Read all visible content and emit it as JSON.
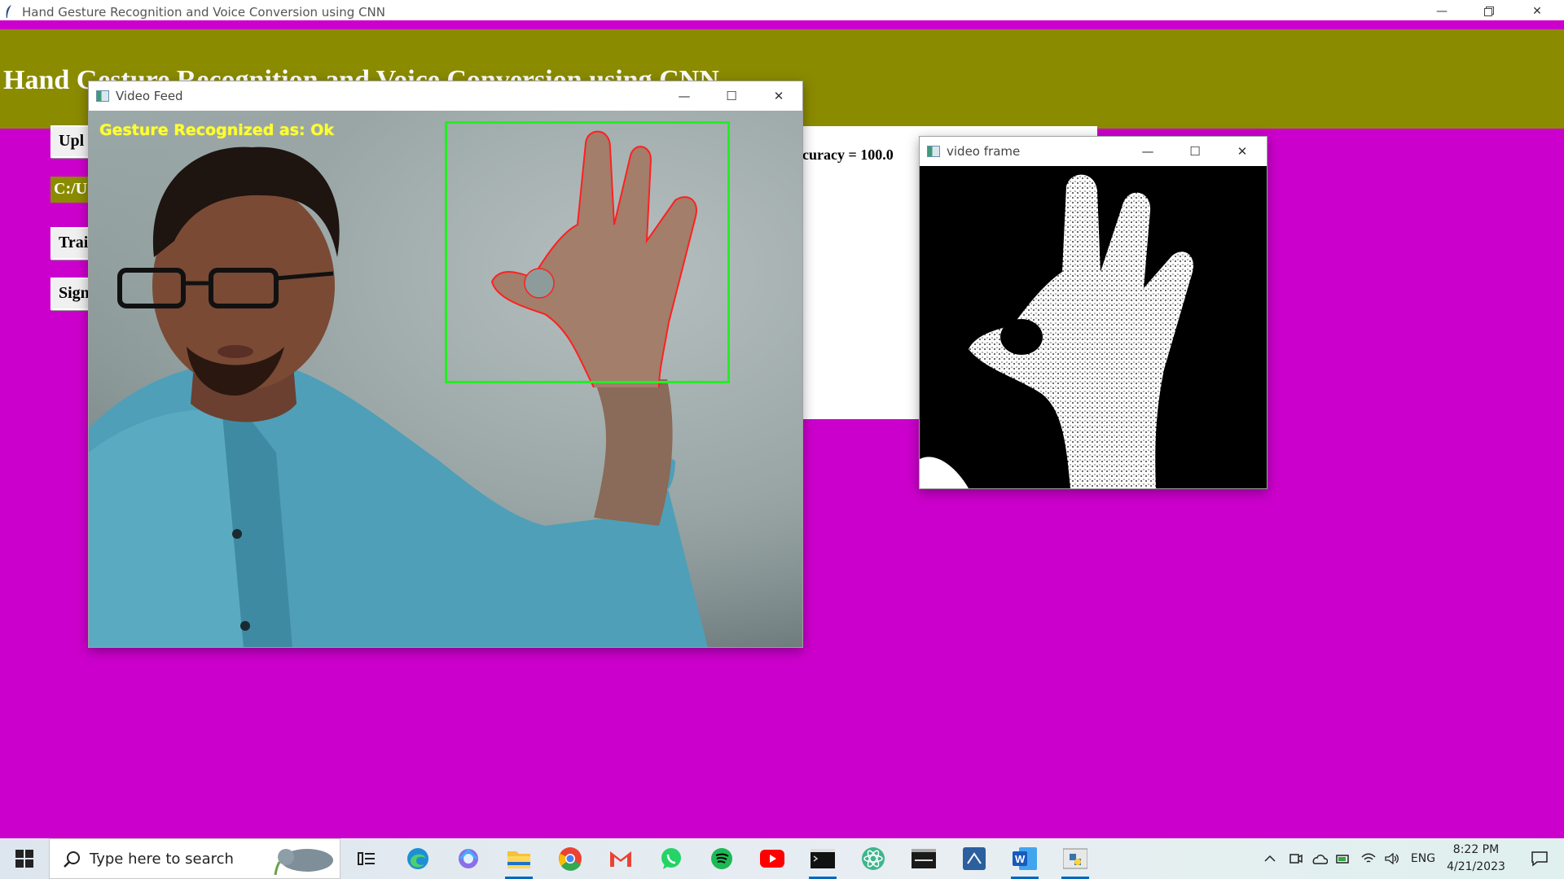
{
  "app": {
    "window_title": "Hand Gesture Recognition and Voice Conversion using CNN",
    "heading": "Hand Gesture Recognition and Voice Conversion using CNN",
    "buttons": [
      "Upl",
      "Trai",
      "Sign"
    ],
    "path_label": "C:/U",
    "accuracy_text": "curacy = 100.0"
  },
  "video_feed": {
    "title": "Video Feed",
    "overlay_text": "Gesture Recognized as: Ok",
    "roi_color": "#22ee22",
    "contour_color": "#ff2020"
  },
  "video_frame": {
    "title": "video frame"
  },
  "window_controls": {
    "minimize": "—",
    "maximize": "☐",
    "close": "✕"
  },
  "taskbar": {
    "search_placeholder": "Type here to search",
    "pinned": [
      "task-view-icon",
      "edge-icon",
      "copilot-icon",
      "file-explorer-icon",
      "chrome-icon",
      "gmail-icon",
      "whatsapp-icon",
      "spotify-icon",
      "youtube-icon",
      "terminal-icon",
      "atom-icon",
      "mysql-icon",
      "visual-studio-icon",
      "word-icon",
      "python-icon"
    ],
    "language": "ENG",
    "time": "8:22 PM",
    "date": "4/21/2023"
  },
  "colors": {
    "background": "#cc00cc",
    "banner": "#8b8b00",
    "accent_label": "#ffff33"
  }
}
